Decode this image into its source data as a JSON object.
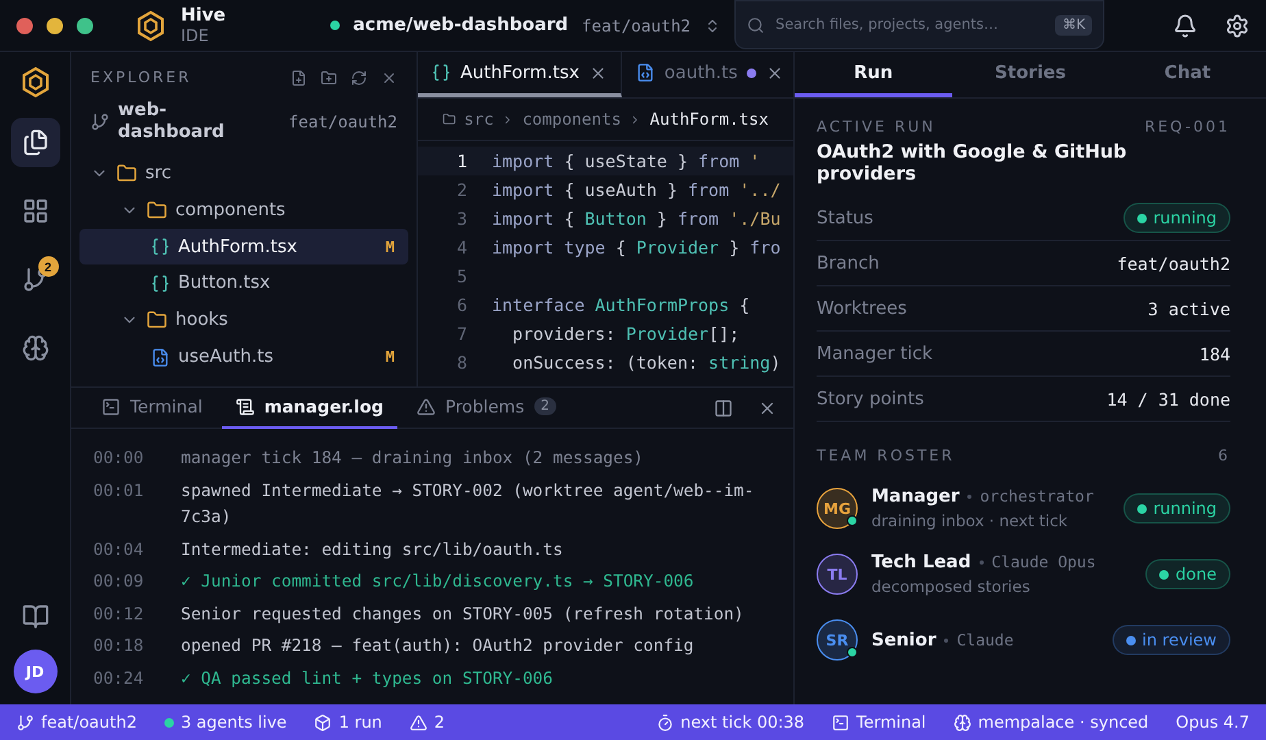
{
  "titlebar": {
    "app_name": "Hive",
    "app_sub": "IDE",
    "repo": "acme/web-dashboard",
    "branch": "feat/oauth2",
    "search": {
      "placeholder": "Search files, projects, agents…",
      "shortcut": "⌘K"
    }
  },
  "activity_bar": [
    {
      "kind": "files",
      "selected": true
    },
    {
      "kind": "grid",
      "selected": false
    },
    {
      "kind": "git",
      "selected": false,
      "badge": "2"
    },
    {
      "kind": "brain",
      "selected": false
    }
  ],
  "activity_bottom": {
    "avatar": "JD"
  },
  "explorer": {
    "title": "EXPLORER",
    "repo": "web-dashboard",
    "branch": "feat/oauth2",
    "tree": [
      {
        "name": "src",
        "kind": "folder",
        "expanded": true,
        "children": [
          {
            "name": "components",
            "kind": "folder",
            "expanded": true,
            "children": [
              {
                "name": "AuthForm.tsx",
                "kind": "tsx",
                "selected": true,
                "status": "M"
              },
              {
                "name": "Button.tsx",
                "kind": "tsx",
                "selected": false
              }
            ]
          },
          {
            "name": "hooks",
            "kind": "folder",
            "expanded": true,
            "children": [
              {
                "name": "useAuth.ts",
                "kind": "ts",
                "selected": false,
                "status": "M"
              }
            ]
          }
        ]
      }
    ]
  },
  "editor": {
    "tabs": [
      {
        "label": "AuthForm.tsx",
        "kind": "tsx",
        "selected": true,
        "modified": false
      },
      {
        "label": "oauth.ts",
        "kind": "ts",
        "selected": false,
        "modified": true
      }
    ],
    "breadcrumbs": [
      "src",
      "components",
      "AuthForm.tsx"
    ],
    "lines": [
      {
        "n": "1",
        "current": true,
        "tokens": [
          {
            "t": "import ",
            "kind": "kw"
          },
          {
            "t": "{ useState } ",
            "kind": "id"
          },
          {
            "t": "from ",
            "kind": "kw"
          },
          {
            "t": "'",
            "kind": "str"
          }
        ]
      },
      {
        "n": "2",
        "current": false,
        "tokens": [
          {
            "t": "import ",
            "kind": "kw"
          },
          {
            "t": "{ useAuth } ",
            "kind": "id"
          },
          {
            "t": "from ",
            "kind": "kw"
          },
          {
            "t": "'../",
            "kind": "str"
          }
        ]
      },
      {
        "n": "3",
        "current": false,
        "tokens": [
          {
            "t": "import ",
            "kind": "kw"
          },
          {
            "t": "{ ",
            "kind": "id"
          },
          {
            "t": "Button",
            "kind": "type"
          },
          {
            "t": " } ",
            "kind": "id"
          },
          {
            "t": "from ",
            "kind": "kw"
          },
          {
            "t": "'./Bu",
            "kind": "str"
          }
        ]
      },
      {
        "n": "4",
        "current": false,
        "tokens": [
          {
            "t": "import type ",
            "kind": "kw"
          },
          {
            "t": "{ ",
            "kind": "id"
          },
          {
            "t": "Provider",
            "kind": "type"
          },
          {
            "t": " } ",
            "kind": "id"
          },
          {
            "t": "fro",
            "kind": "kw"
          }
        ]
      },
      {
        "n": "5",
        "current": false
      },
      {
        "n": "6",
        "current": false,
        "tokens": [
          {
            "t": "interface ",
            "kind": "kw"
          },
          {
            "t": "AuthFormProps",
            "kind": "type"
          },
          {
            "t": " {",
            "kind": "id"
          }
        ]
      },
      {
        "n": "7",
        "current": false,
        "tokens": [
          {
            "t": "  providers: ",
            "kind": "id"
          },
          {
            "t": "Provider",
            "kind": "type"
          },
          {
            "t": "[];",
            "kind": "id"
          }
        ]
      },
      {
        "n": "8",
        "current": false,
        "tokens": [
          {
            "t": "  onSuccess: (token: ",
            "kind": "id"
          },
          {
            "t": "string",
            "kind": "type"
          },
          {
            "t": ")",
            "kind": "id"
          }
        ]
      }
    ]
  },
  "bottom_panel": {
    "tabs": [
      {
        "label": "Terminal",
        "kind": "terminal",
        "selected": false
      },
      {
        "label": "manager.log",
        "kind": "log",
        "selected": true
      },
      {
        "label": "Problems",
        "kind": "problems",
        "selected": false,
        "count": "2"
      }
    ],
    "log": [
      {
        "time": "00:00",
        "text": "manager tick 184 — draining inbox (2 messages)",
        "kind": "dim"
      },
      {
        "time": "00:01",
        "text": "spawned Intermediate → STORY-002 (worktree agent/web--im-7c3a)",
        "kind": "info"
      },
      {
        "time": "00:04",
        "text": "Intermediate: editing src/lib/oauth.ts",
        "kind": "info"
      },
      {
        "time": "00:09",
        "text": "✓ Junior committed src/lib/discovery.ts → STORY-006",
        "kind": "success"
      },
      {
        "time": "00:12",
        "text": "Senior requested changes on STORY-005 (refresh rotation)",
        "kind": "info"
      },
      {
        "time": "00:18",
        "text": "opened PR #218 — feat(auth): OAuth2 provider config",
        "kind": "info"
      },
      {
        "time": "00:24",
        "text": "✓ QA passed lint + types on STORY-006",
        "kind": "success"
      }
    ]
  },
  "right_panel": {
    "tabs": [
      {
        "label": "Run",
        "selected": true
      },
      {
        "label": "Stories",
        "selected": false
      },
      {
        "label": "Chat",
        "selected": false
      }
    ],
    "active_run": {
      "label": "ACTIVE RUN",
      "id": "REQ-001",
      "title": "OAuth2 with Google & GitHub providers"
    },
    "properties": [
      {
        "label": "Status",
        "kind": "badge",
        "value": "running",
        "color": "#2bd4a4"
      },
      {
        "label": "Branch",
        "kind": "mono",
        "value": "feat/oauth2"
      },
      {
        "label": "Worktrees",
        "kind": "mono",
        "value": "3 active"
      },
      {
        "label": "Manager tick",
        "kind": "mono",
        "value": "184"
      },
      {
        "label": "Story points",
        "kind": "mono",
        "value": "14 / 31 done"
      }
    ],
    "roster": {
      "label": "TEAM ROSTER",
      "count": "6",
      "members": [
        {
          "initials": "MG",
          "color": "#e8a33d",
          "name": "Manager",
          "role": "orchestrator",
          "activity": "draining inbox · next tick",
          "status": {
            "label": "running",
            "color": "#2bd4a4"
          },
          "online": true
        },
        {
          "initials": "TL",
          "color": "#8b7cf0",
          "name": "Tech Lead",
          "role": "Claude Opus",
          "activity": "decomposed stories",
          "status": {
            "label": "done",
            "color": "#2bd4a4"
          },
          "online": false
        },
        {
          "initials": "SR",
          "color": "#4a8ef0",
          "name": "Senior",
          "role": "Claude",
          "status": {
            "label": "in review",
            "color": "#4a8ef0"
          },
          "online": true
        }
      ]
    }
  },
  "status_bar": {
    "branch": "feat/oauth2",
    "agents": "3  agents live",
    "runs": "1 run",
    "warnings": "2",
    "next_tick": "next tick 00:38",
    "terminal": "Terminal",
    "memory": "mempalace · synced",
    "model": "Opus 4.7"
  }
}
